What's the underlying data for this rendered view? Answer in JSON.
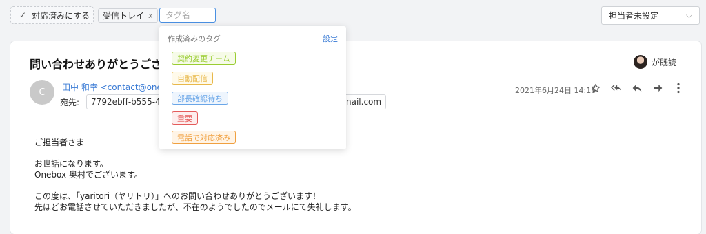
{
  "toolbar": {
    "done_label": "対応済みにする",
    "done_icon": "check-icon",
    "active_tag": "受信トレイ",
    "remove_icon": "x",
    "tag_input_placeholder": "タグ名",
    "assignee_value": "担当者未設定"
  },
  "dropdown": {
    "title": "作成済みのタグ",
    "settings_label": "設定",
    "tags": [
      {
        "label": "契約変更チーム",
        "color": "#9acd32",
        "bg": "#f6fbe8"
      },
      {
        "label": "自動配信",
        "color": "#e8b84a",
        "bg": "#fffaea"
      },
      {
        "label": "部長確認待ち",
        "color": "#6aa6e8",
        "bg": "#eef5fd"
      },
      {
        "label": "重要",
        "color": "#e45b5b",
        "bg": "#fdeeee"
      },
      {
        "label": "電話で対応済み",
        "color": "#f0a040",
        "bg": "#fff4e6"
      }
    ]
  },
  "mail": {
    "subject": "問い合わせありがとうござい",
    "read_by": "が既読",
    "avatar_initial": "C",
    "from": "田中 和幸 <contact@onebox",
    "to_label": "宛先:",
    "to_chip_1": "7792ebff-b555-499",
    "to_chip_2": "nail.com",
    "date": "2021年6月24日 14:16",
    "body": [
      "ご担当者さま",
      "",
      "お世話になります。",
      "Onebox 奥村でございます。",
      "",
      "この度は、「yaritori（ヤリトリ）」へのお問い合わせありがとうございます！",
      "先ほどお電話させていただきましたが、不在のようでしたのでメールにて失礼します。"
    ]
  },
  "icons": {
    "star": "star-icon",
    "reply_all": "reply-all-icon",
    "reply": "reply-icon",
    "forward": "forward-icon",
    "more": "more-vertical-icon"
  }
}
